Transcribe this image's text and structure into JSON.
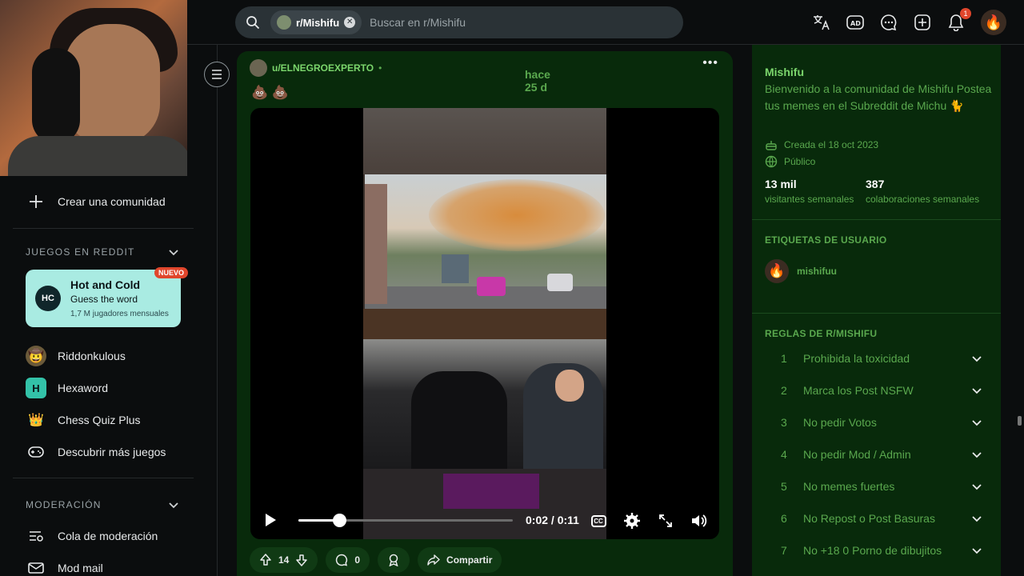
{
  "search": {
    "community_chip": "r/Mishifu",
    "placeholder": "Buscar en r/Mishifu"
  },
  "topbar": {
    "notification_count": "1"
  },
  "sidebar": {
    "create_community": "Crear una comunidad",
    "games_header": "JUEGOS EN REDDIT",
    "featured_game": {
      "title": "Hot and Cold",
      "subtitle": "Guess the word",
      "players": "1,7 M jugadores mensuales",
      "badge": "NUEVO"
    },
    "games": [
      {
        "label": "Riddonkulous"
      },
      {
        "label": "Hexaword"
      },
      {
        "label": "Chess Quiz Plus"
      },
      {
        "label": "Descubrir más juegos"
      }
    ],
    "moderation_header": "MODERACIÓN",
    "moderation": [
      {
        "label": "Cola de moderación"
      },
      {
        "label": "Mod mail"
      }
    ]
  },
  "post": {
    "author": "u/ELNEGROEXPERTO",
    "time": "hace 25 d",
    "body": "💩 💩",
    "video": {
      "current": "0:02",
      "total": "0:11",
      "progress": 0.19
    },
    "votes": "14",
    "comments": "0",
    "share_label": "Compartir"
  },
  "community": {
    "name": "Mishifu",
    "description": "Bienvenido a la comunidad de Mishifu Postea tus memes en el Subreddit de Michu 🐈",
    "created": "Creada el 18 oct 2023",
    "visibility": "Público",
    "visitors": "13 mil",
    "visitors_label": "visitantes semanales",
    "contributions": "387",
    "contributions_label": "colaboraciones semanales",
    "user_flair_header": "ETIQUETAS DE USUARIO",
    "user_flair": "mishifuu",
    "rules_header": "REGLAS DE R/MISHIFU",
    "rules": [
      {
        "n": "1",
        "text": "Prohibida la toxicidad"
      },
      {
        "n": "2",
        "text": "Marca los Post NSFW"
      },
      {
        "n": "3",
        "text": "No pedir Votos"
      },
      {
        "n": "4",
        "text": "No pedir Mod / Admin"
      },
      {
        "n": "5",
        "text": "No memes fuertes"
      },
      {
        "n": "6",
        "text": "No Repost o Post Basuras"
      },
      {
        "n": "7",
        "text": "No +18 0 Porno de dibujitos"
      }
    ]
  }
}
